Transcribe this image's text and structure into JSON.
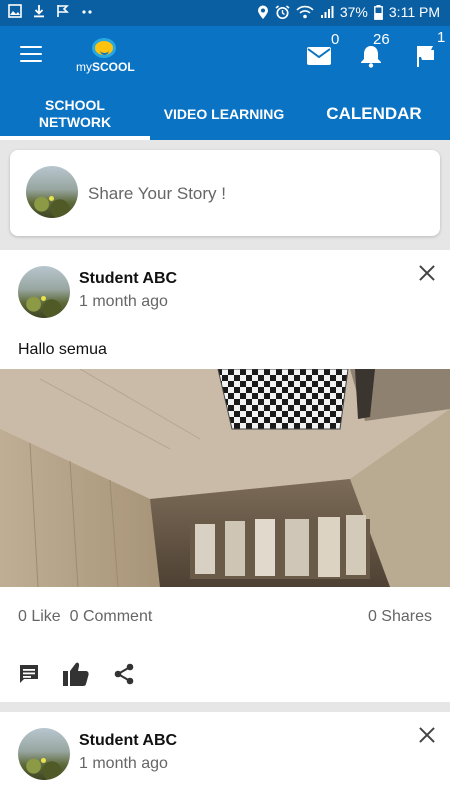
{
  "status_bar": {
    "battery": "37%",
    "time": "3:11 PM"
  },
  "app_bar": {
    "logo_text_prefix": "my",
    "logo_text_bold": "SCOOL",
    "mail_count": "0",
    "notification_count": "26",
    "flag_count": "1"
  },
  "tabs": [
    {
      "label_line1": "SCHOOL",
      "label_line2": "NETWORK",
      "active": true
    },
    {
      "label": "VIDEO LEARNING",
      "active": false
    },
    {
      "label": "CALENDAR",
      "active": false
    }
  ],
  "share": {
    "placeholder": "Share Your Story !"
  },
  "posts": [
    {
      "author": "Student ABC",
      "time": "1 month ago",
      "text": "Hallo semua",
      "likes": "0 Like",
      "comments": "0 Comment",
      "shares": "0 Shares"
    },
    {
      "author": "Student ABC",
      "time": "1 month ago"
    }
  ],
  "colors": {
    "primary": "#0b73c3",
    "status_bar": "#0a5fa3",
    "background": "#e6e6e6"
  }
}
